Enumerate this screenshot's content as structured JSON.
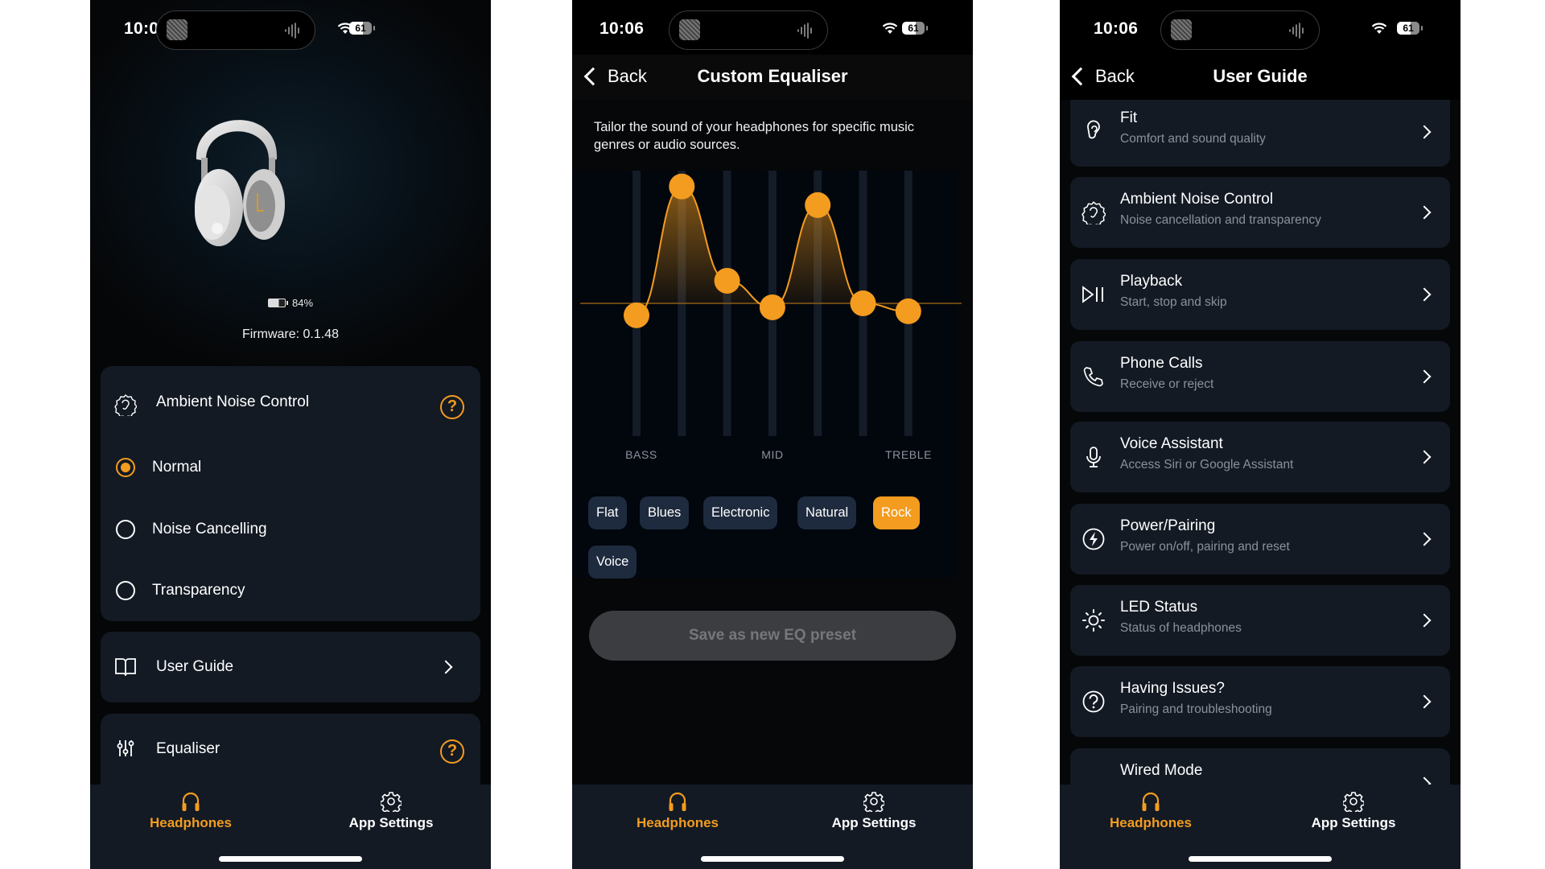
{
  "colors": {
    "accent": "#f39c1f",
    "card": "#131a24",
    "chip": "#1e2a3d",
    "muted_text": "#8a919b"
  },
  "screens": [
    {
      "status": {
        "time": "10:05",
        "battery": "61"
      },
      "device": {
        "image": "white over-ear headphones",
        "battery_icon": "battery-icon",
        "battery_percent": "84%",
        "firmware": "Firmware: 0.1.48"
      },
      "anc_card": {
        "icon": "ear-icon",
        "title": "Ambient Noise Control",
        "help_icon": "help-icon",
        "options": [
          {
            "label": "Normal",
            "selected": true
          },
          {
            "label": "Noise Cancelling",
            "selected": false
          },
          {
            "label": "Transparency",
            "selected": false
          }
        ]
      },
      "user_guide_card": {
        "icon": "book-icon",
        "title": "User Guide",
        "chevron": "chevron-right-icon"
      },
      "equaliser_card": {
        "icon": "sliders-icon",
        "title": "Equaliser",
        "help_icon": "help-icon"
      },
      "tabbar": [
        {
          "label": "Headphones",
          "icon": "headphones-icon",
          "active": true
        },
        {
          "label": "App Settings",
          "icon": "gear-icon",
          "active": false
        }
      ]
    },
    {
      "status": {
        "time": "10:06",
        "battery": "61"
      },
      "nav": {
        "back": "Back",
        "title": "Custom Equaliser"
      },
      "description": "Tailor the sound of your headphones for specific music genres or audio sources.",
      "eq_labels": [
        "BASS",
        "MID",
        "TREBLE"
      ],
      "presets": [
        {
          "label": "Flat",
          "active": false
        },
        {
          "label": "Blues",
          "active": false
        },
        {
          "label": "Electronic",
          "active": false
        },
        {
          "label": "Natural",
          "active": false
        },
        {
          "label": "Rock",
          "active": true
        },
        {
          "label": "Voice",
          "active": false
        }
      ],
      "save_button": "Save as new EQ preset",
      "tabbar": [
        {
          "label": "Headphones",
          "icon": "headphones-icon",
          "active": true
        },
        {
          "label": "App Settings",
          "icon": "gear-icon",
          "active": false
        }
      ]
    },
    {
      "status": {
        "time": "10:06",
        "battery": "61"
      },
      "nav": {
        "back": "Back",
        "title": "User Guide"
      },
      "items": [
        {
          "icon": "ear-icon",
          "title": "Fit",
          "subtitle": "Comfort and sound quality"
        },
        {
          "icon": "ambient-ear-icon",
          "title": "Ambient Noise Control",
          "subtitle": "Noise cancellation and transparency"
        },
        {
          "icon": "play-pause-icon",
          "title": "Playback",
          "subtitle": "Start, stop and skip"
        },
        {
          "icon": "phone-icon",
          "title": "Phone Calls",
          "subtitle": "Receive or reject"
        },
        {
          "icon": "microphone-icon",
          "title": "Voice Assistant",
          "subtitle": "Access Siri or Google Assistant"
        },
        {
          "icon": "power-bolt-icon",
          "title": "Power/Pairing",
          "subtitle": "Power on/off, pairing and reset"
        },
        {
          "icon": "sun-icon",
          "title": "LED Status",
          "subtitle": "Status of headphones"
        },
        {
          "icon": "question-icon",
          "title": "Having Issues?",
          "subtitle": "Pairing and troubleshooting"
        },
        {
          "icon": "wired-icon",
          "title": "Wired Mode",
          "subtitle": ""
        }
      ],
      "tabbar": [
        {
          "label": "Headphones",
          "icon": "headphones-icon",
          "active": true
        },
        {
          "label": "App Settings",
          "icon": "gear-icon",
          "active": false
        }
      ]
    }
  ],
  "chart_data": {
    "type": "line",
    "title": "Custom Equaliser (Rock preset)",
    "x": [
      1,
      2,
      3,
      4,
      5,
      6,
      7
    ],
    "tick_labels": [
      "BASS",
      "MID",
      "TREBLE"
    ],
    "series": [
      {
        "name": "gain (normalized, -1 to 1)",
        "values": [
          -0.09,
          0.88,
          0.17,
          -0.03,
          0.74,
          0.0,
          -0.06
        ]
      }
    ],
    "ylim": [
      -1,
      1
    ],
    "xlabel": "",
    "ylabel": "",
    "grid": false,
    "legend": "none"
  }
}
